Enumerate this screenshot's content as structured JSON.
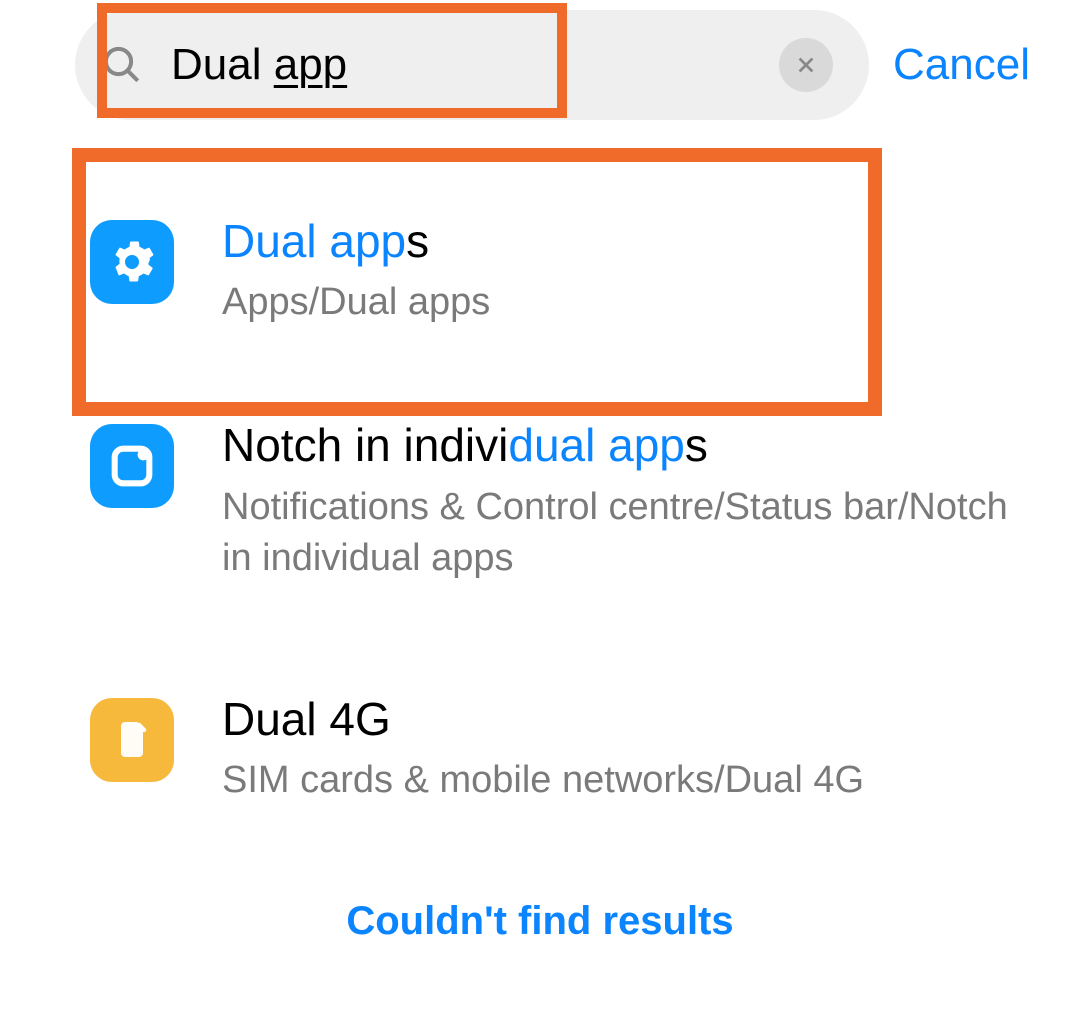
{
  "search": {
    "query_prefix": "Dual ",
    "query_underlined": "app",
    "cancel_label": "Cancel"
  },
  "results": [
    {
      "icon": "gear-icon",
      "icon_color": "blue",
      "title_before": "",
      "title_match": "Dual app",
      "title_after": "s",
      "path": "Apps/Dual apps"
    },
    {
      "icon": "notch-icon",
      "icon_color": "blue",
      "title_before": "Notch in indivi",
      "title_match": "dual app",
      "title_after": "s",
      "path": "Notifications & Control centre/Status bar/Notch in individual apps"
    },
    {
      "icon": "sim-icon",
      "icon_color": "yellow",
      "title_before": "Dual 4G",
      "title_match": "",
      "title_after": "",
      "path": "SIM cards & mobile networks/Dual 4G"
    }
  ],
  "footer": {
    "no_results_label": "Couldn't find results"
  },
  "annotations": {
    "highlight_color": "#f06a2a"
  }
}
